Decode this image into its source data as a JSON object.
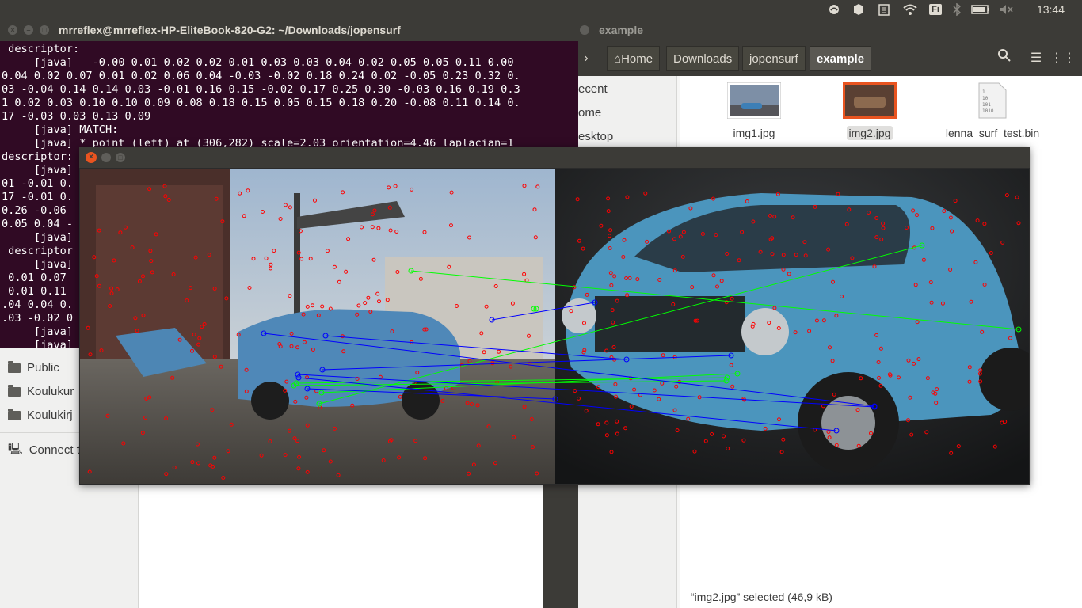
{
  "top_panel": {
    "clock": "13:44",
    "keyboard_layout": "Fi",
    "icons": [
      "dropbox-icon",
      "update-icon",
      "clipboard-icon",
      "wifi-icon",
      "keyboard-icon",
      "bluetooth-icon",
      "battery-icon",
      "volume-muted-icon"
    ]
  },
  "terminal": {
    "title": "mrreflex@mrreflex-HP-EliteBook-820-G2: ~/Downloads/jopensurf",
    "lines": [
      " descriptor:",
      "     [java]   -0.00 0.01 0.02 0.02 0.01 0.03 0.03 0.04 0.02 0.05 0.05 0.11 0.00",
      "0.04 0.02 0.07 0.01 0.02 0.06 0.04 -0.03 -0.02 0.18 0.24 0.02 -0.05 0.23 0.32 0.",
      "03 -0.04 0.14 0.14 0.03 -0.01 0.16 0.15 -0.02 0.17 0.25 0.30 -0.03 0.16 0.19 0.3",
      "1 0.02 0.03 0.10 0.10 0.09 0.08 0.18 0.15 0.05 0.15 0.18 0.20 -0.08 0.11 0.14 0.",
      "17 -0.03 0.03 0.13 0.09",
      "     [java] MATCH:",
      "     [java] * point (left) at (306,282) scale=2.03 orientation=4.46 laplacian=1",
      "descriptor:",
      "     [java]",
      "01 -0.01 0.",
      "17 -0.01 0.",
      "0.26 -0.06",
      "0.05 0.04 -",
      "     [java]",
      " descriptor",
      "     [java]",
      " 0.01 0.07",
      " 0.01 0.11",
      ".04 0.04 0.",
      ".03 -0.02 0",
      "     [java]",
      "     [java]"
    ]
  },
  "files": {
    "title": "example",
    "path": [
      "Home",
      "Downloads",
      "jopensurf",
      "example"
    ],
    "sidebar": [
      "ecent",
      "ome",
      "esktop"
    ],
    "items": [
      {
        "name": "img1.jpg"
      },
      {
        "name": "img2.jpg"
      },
      {
        "name": "lenna_surf_test.bin",
        "thumb_text": "1\n10\n101\n1010"
      }
    ],
    "status": "“img2.jpg” selected  (46,9 kB)"
  },
  "left_panel": {
    "items": [
      "Public",
      "Koulukur",
      "Koulukirj",
      "Connect t"
    ]
  },
  "match_window": {
    "title": "",
    "colors": {
      "keypoint": "#ff0000",
      "match_green": "#00ff00",
      "match_blue": "#0000ff"
    }
  }
}
